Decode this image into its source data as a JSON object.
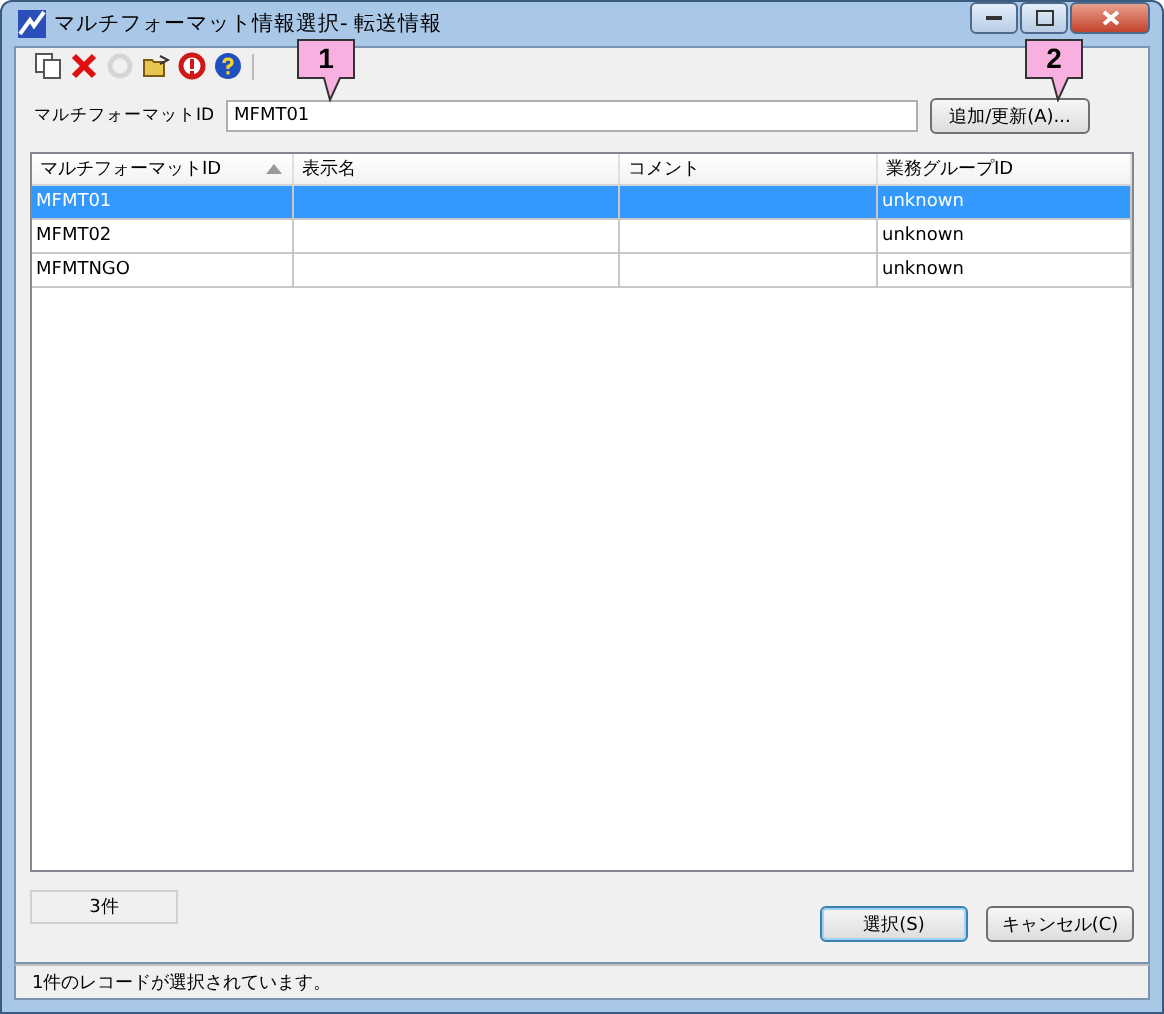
{
  "window": {
    "title": "マルチフォーマット情報選択- 転送情報"
  },
  "toolbar": [
    {
      "kind": "copy",
      "disabled": false
    },
    {
      "kind": "delete",
      "disabled": false
    },
    {
      "kind": "refresh",
      "disabled": true
    },
    {
      "kind": "open",
      "disabled": false
    },
    {
      "kind": "alert",
      "disabled": false
    },
    {
      "kind": "help",
      "disabled": false
    }
  ],
  "id_field": {
    "label": "マルチフォーマットID",
    "value": "MFMT01"
  },
  "add_button": "追加/更新(A)...",
  "table": {
    "columns": [
      {
        "label": "マルチフォーマットID",
        "sorted": true
      },
      {
        "label": "表示名",
        "sorted": false
      },
      {
        "label": "コメント",
        "sorted": false
      },
      {
        "label": "業務グループID",
        "sorted": false
      }
    ],
    "rows": [
      {
        "cells": [
          "MFMT01",
          "",
          "",
          "unknown"
        ],
        "selected": true
      },
      {
        "cells": [
          "MFMT02",
          "",
          "",
          "unknown"
        ],
        "selected": false
      },
      {
        "cells": [
          "MFMTNGO",
          "",
          "",
          "unknown"
        ],
        "selected": false
      }
    ]
  },
  "count": "3件",
  "buttons": [
    {
      "label": "選択(S)",
      "default": true
    },
    {
      "label": "キャンセル(C)",
      "default": false
    }
  ],
  "status_bar": "1件のレコードが選択されています。",
  "callouts": [
    {
      "number": "1"
    },
    {
      "number": "2"
    }
  ]
}
